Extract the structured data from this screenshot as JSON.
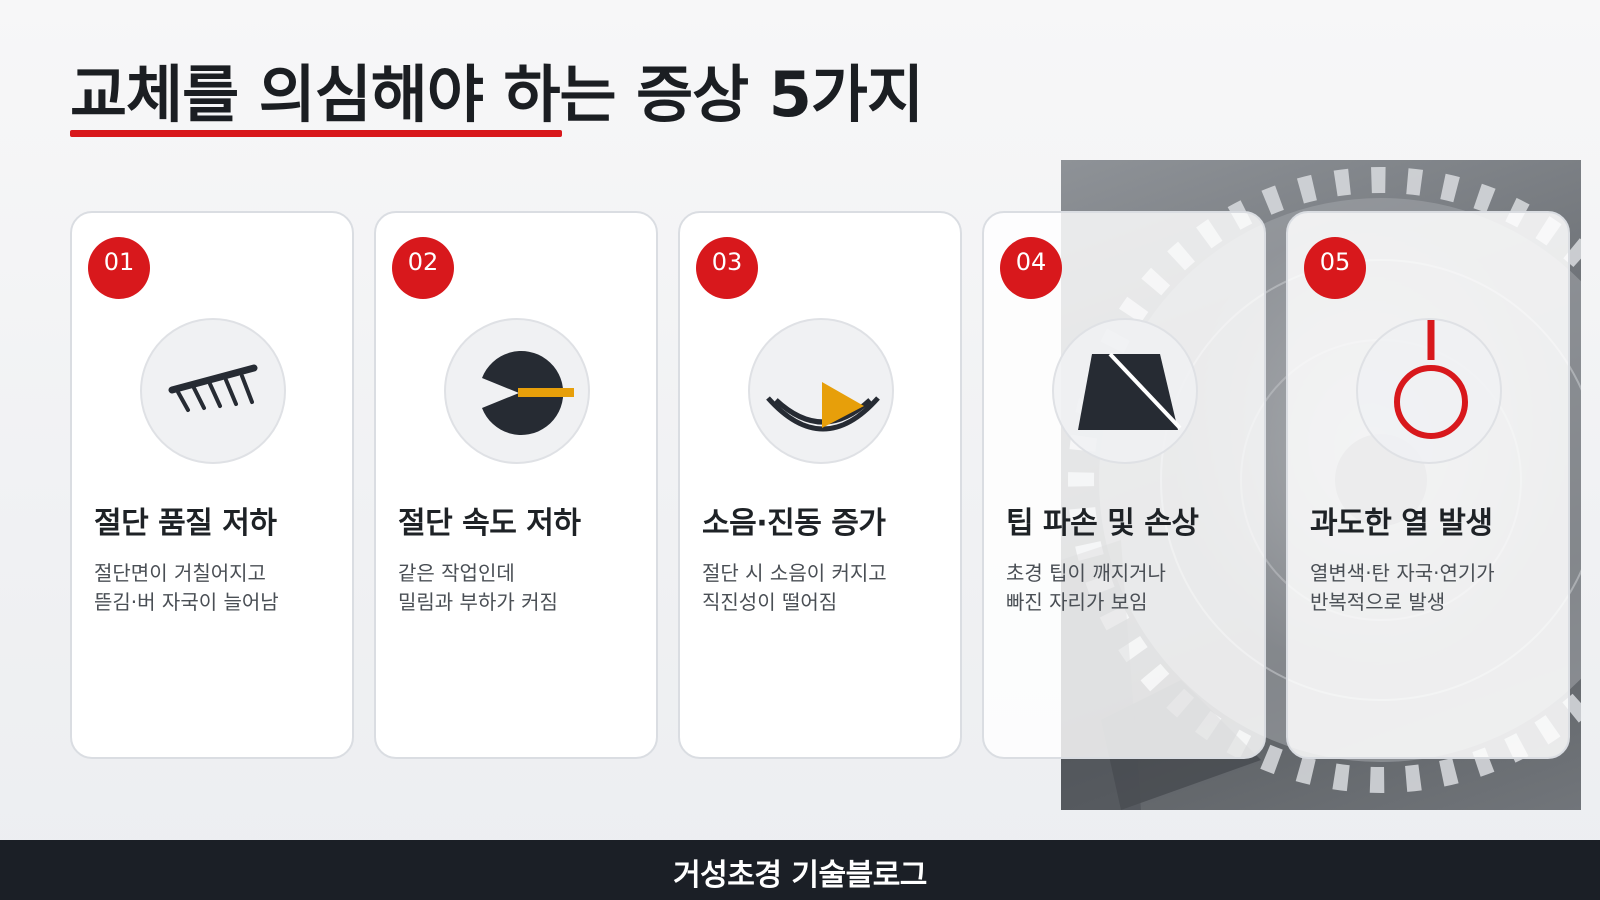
{
  "title": "교체를 의심해야 하는 증상 5가지",
  "colors": {
    "accent": "#d8181c",
    "dark": "#262b33",
    "highlight": "#e79f0a",
    "footer_bg": "#1b1f26"
  },
  "cards": [
    {
      "number": "01",
      "icon": "comb-marks-icon",
      "title": "절단 품질 저하",
      "desc": [
        "절단면이 거칠어지고",
        "뜯김·버 자국이 늘어남"
      ]
    },
    {
      "number": "02",
      "icon": "pie-gauge-icon",
      "title": "절단 속도 저하",
      "desc": [
        "같은 작업인데",
        "밀림과 부하가 커짐"
      ]
    },
    {
      "number": "03",
      "icon": "vibration-play-icon",
      "title": "소음·진동 증가",
      "desc": [
        "절단 시 소음이 커지고",
        "직진성이 떨어짐"
      ]
    },
    {
      "number": "04",
      "icon": "broken-tip-icon",
      "title": "팁 파손 및 손상",
      "desc": [
        "초경 팁이 깨지거나",
        "빠진 자리가 보임"
      ]
    },
    {
      "number": "05",
      "icon": "heat-ring-icon",
      "title": "과도한 열 발생",
      "desc": [
        "열변색·탄 자국·연기가",
        "반복적으로 발생"
      ]
    }
  ],
  "footer": {
    "text": "거성초경 기술블로그"
  }
}
